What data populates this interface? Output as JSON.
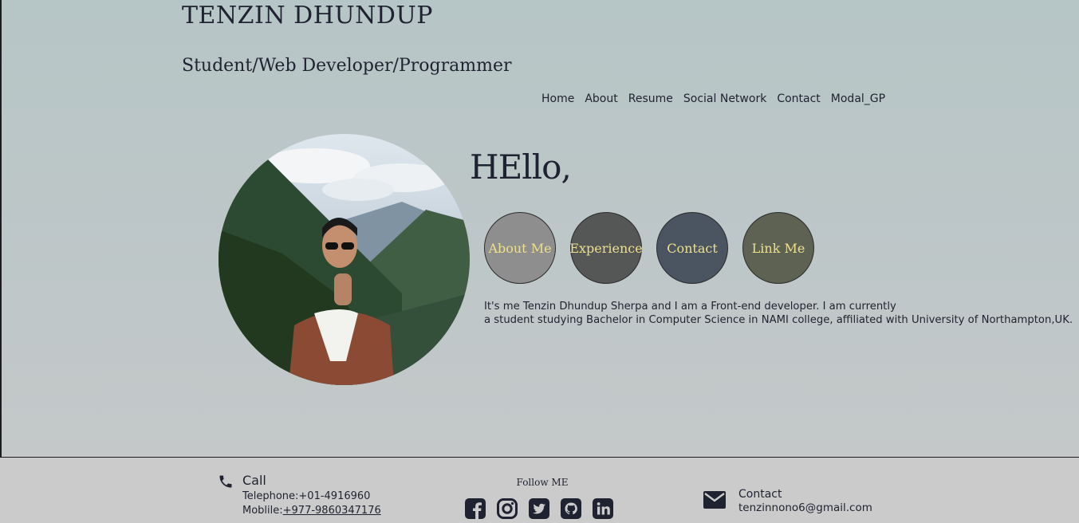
{
  "header": {
    "title": "TENZIN DHUNDUP",
    "subtitle": "Student/Web Developer/Programmer"
  },
  "nav": {
    "items": [
      "Home",
      "About",
      "Resume",
      "Social Network",
      "Contact",
      "Modal_GP"
    ]
  },
  "hero": {
    "greeting": "HEllo,",
    "buttons": [
      {
        "label": "About Me",
        "color": "#8e8e8e"
      },
      {
        "label": "Experience",
        "color": "#555656"
      },
      {
        "label": "Contact",
        "color": "#4a5561"
      },
      {
        "label": "Link Me",
        "color": "#5e6253"
      }
    ],
    "intro_line1": "It's me Tenzin Dhundup Sherpa and I am a Front-end developer. I am currently",
    "intro_line2": "a student studying Bachelor in Computer Science in NAMI college, affiliated with University of Northampton,UK."
  },
  "footer": {
    "call": {
      "title": "Call",
      "telephone": "Telephone:+01-4916960",
      "mobile_label": "Moblile:",
      "mobile_number": "+977-9860347176",
      "icon": "phone-icon"
    },
    "follow": {
      "title": "Follow ME",
      "icons": [
        "facebook-icon",
        "instagram-icon",
        "twitter-icon",
        "github-icon",
        "linkedin-icon"
      ]
    },
    "contact": {
      "title": "Contact",
      "email": "tenzinnono6@gmail.com",
      "icon": "mail-icon"
    }
  },
  "colors": {
    "text": "#1f2230",
    "button_text": "#ece08d",
    "page_bg_top": "#b6c5c6",
    "footer_bg": "#cbcbcb"
  }
}
